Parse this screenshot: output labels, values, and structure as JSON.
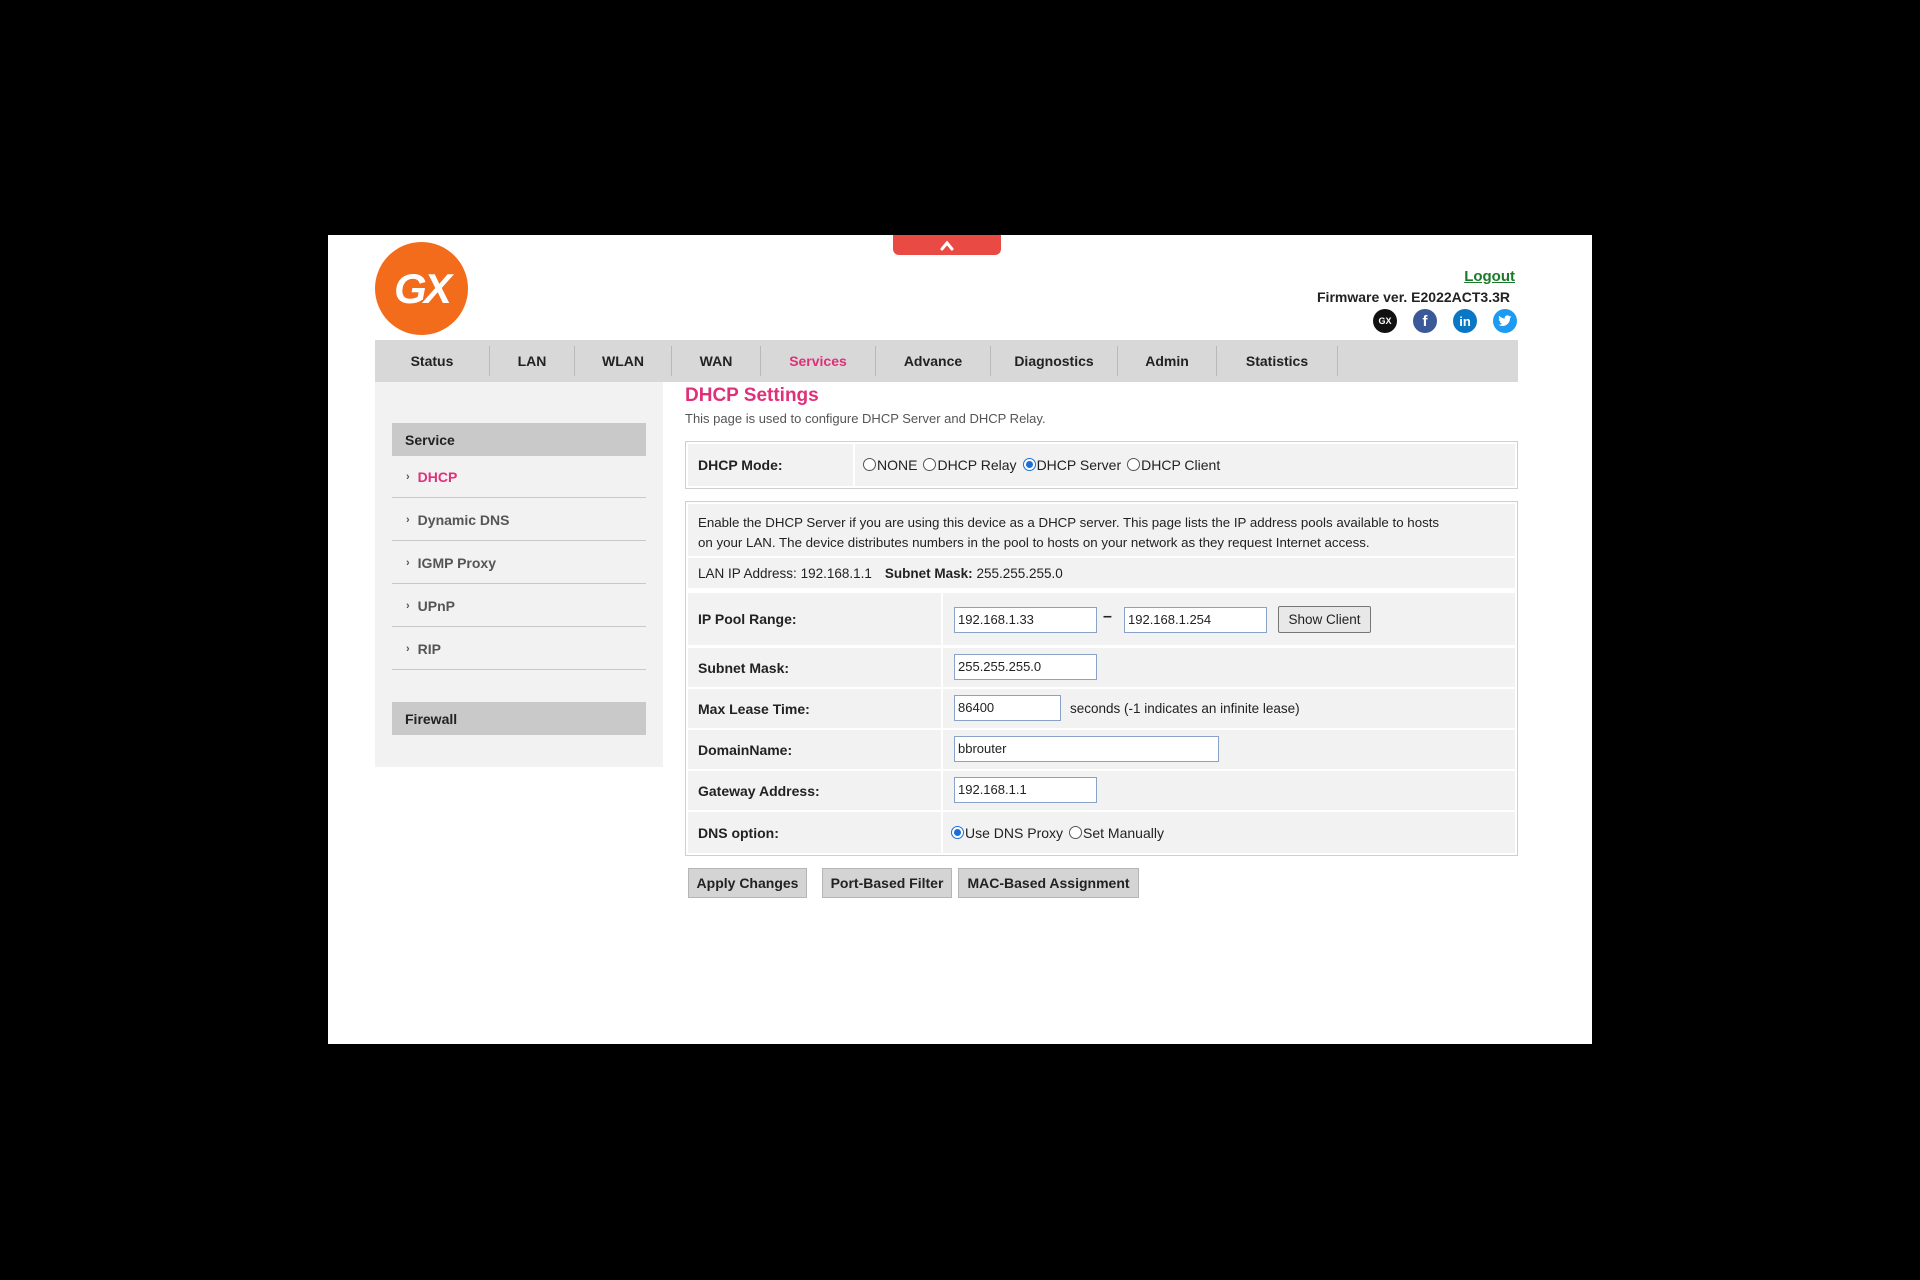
{
  "header": {
    "logo_text": "GX",
    "logout_label": "Logout",
    "firmware": "Firmware ver. E2022ACT3.3R",
    "social": [
      {
        "icon": "gx-icon",
        "glyph": "GX",
        "color": "#111111"
      },
      {
        "icon": "facebook-icon",
        "glyph": "f",
        "color": "#3b5998"
      },
      {
        "icon": "linkedin-icon",
        "glyph": "in",
        "color": "#0a77c5"
      },
      {
        "icon": "twitter-icon",
        "glyph": "t",
        "color": "#1d9bf0"
      }
    ]
  },
  "nav": {
    "items": [
      "Status",
      "LAN",
      "WLAN",
      "WAN",
      "Services",
      "Advance",
      "Diagnostics",
      "Admin",
      "Statistics"
    ],
    "active": "Services"
  },
  "sidebar": {
    "sections": [
      {
        "label": "Service"
      },
      {
        "label": "Firewall"
      }
    ],
    "items": [
      {
        "label": "DHCP",
        "active": true
      },
      {
        "label": "Dynamic DNS"
      },
      {
        "label": "IGMP Proxy"
      },
      {
        "label": "UPnP"
      },
      {
        "label": "RIP"
      }
    ]
  },
  "page": {
    "title": "DHCP Settings",
    "subtitle": "This page is used to configure DHCP Server and DHCP Relay."
  },
  "mode": {
    "label": "DHCP Mode:",
    "options": [
      "NONE",
      "DHCP Relay",
      "DHCP Server",
      "DHCP Client"
    ],
    "selected": "DHCP Server"
  },
  "server": {
    "description_line1": "Enable the DHCP Server if you are using this device as a DHCP server. This page lists the IP address pools available to hosts",
    "description_line2": "on your LAN. The device distributes numbers in the pool to hosts on your network as they request Internet access.",
    "lan_ip_label": "LAN IP Address:",
    "lan_ip": "192.168.1.1",
    "subnet_label": "Subnet Mask:",
    "subnet": "255.255.255.0",
    "pool_label": "IP Pool Range:",
    "pool_start": "192.168.1.33",
    "pool_dash": "–",
    "pool_end": "192.168.1.254",
    "show_client_label": "Show Client",
    "mask_label": "Subnet Mask:",
    "mask_value": "255.255.255.0",
    "lease_label": "Max Lease Time:",
    "lease_value": "86400",
    "lease_note": "seconds (-1 indicates an infinite lease)",
    "domain_label": "DomainName:",
    "domain_value": "bbrouter",
    "gateway_label": "Gateway Address:",
    "gateway_value": "192.168.1.1",
    "dns_label": "DNS option:",
    "dns_options": [
      "Use DNS Proxy",
      "Set Manually"
    ],
    "dns_selected": "Use DNS Proxy"
  },
  "buttons": {
    "apply": "Apply Changes",
    "port_filter": "Port-Based Filter",
    "mac_assign": "MAC-Based Assignment"
  }
}
